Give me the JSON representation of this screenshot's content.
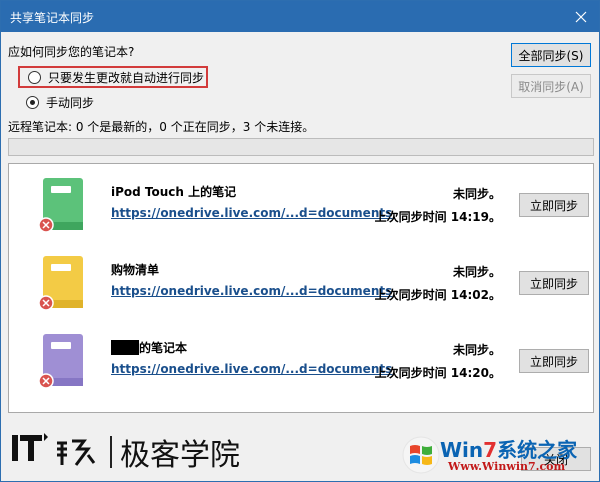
{
  "window": {
    "title": "共享笔记本同步"
  },
  "question": "应如何同步您的笔记本?",
  "options": [
    {
      "label": "只要发生更改就自动进行同步",
      "checked": false,
      "highlighted": true
    },
    {
      "label": "手动同步",
      "checked": true,
      "highlighted": false
    }
  ],
  "summary": "远程笔记本: 0 个是最新的，0 个正在同步，3 个未连接。",
  "progress": 0,
  "buttons": {
    "sync_all": "全部同步(S)",
    "cancel_sync": "取消同步(A)",
    "close": "关闭"
  },
  "notebooks": [
    {
      "name": "iPod Touch 上的笔记",
      "link": "https://onedrive.live.com/...d=documents",
      "status": "未同步。",
      "last_sync": "上次同步时间 14:19。",
      "button": "立即同步",
      "color": "#5cc27a",
      "color_dark": "#3fa65e",
      "redacted_prefix": false
    },
    {
      "name": "购物清单",
      "link": "https://onedrive.live.com/...d=documents",
      "status": "未同步。",
      "last_sync": "上次同步时间 14:02。",
      "button": "立即同步",
      "color": "#f3cb45",
      "color_dark": "#e0b32a",
      "redacted_prefix": false
    },
    {
      "name": "的笔记本",
      "link": "https://onedrive.live.com/...d=documents",
      "status": "未同步。",
      "last_sync": "上次同步时间 14:20。",
      "button": "立即同步",
      "color": "#9f8fd4",
      "color_dark": "#8676c4",
      "redacted_prefix": true
    }
  ],
  "watermarks": {
    "left_brand": "IT",
    "left_name": "极客学院",
    "right_brand_a": "Win",
    "right_brand_7": "7",
    "right_brand_b": "系统之家",
    "right_url": "Www.Winwin7.com"
  },
  "colors": {
    "titlebar": "#2a6cb1",
    "highlight_border": "#d23b3b",
    "link": "#1a4f8c",
    "error_badge": "#d9534f"
  }
}
